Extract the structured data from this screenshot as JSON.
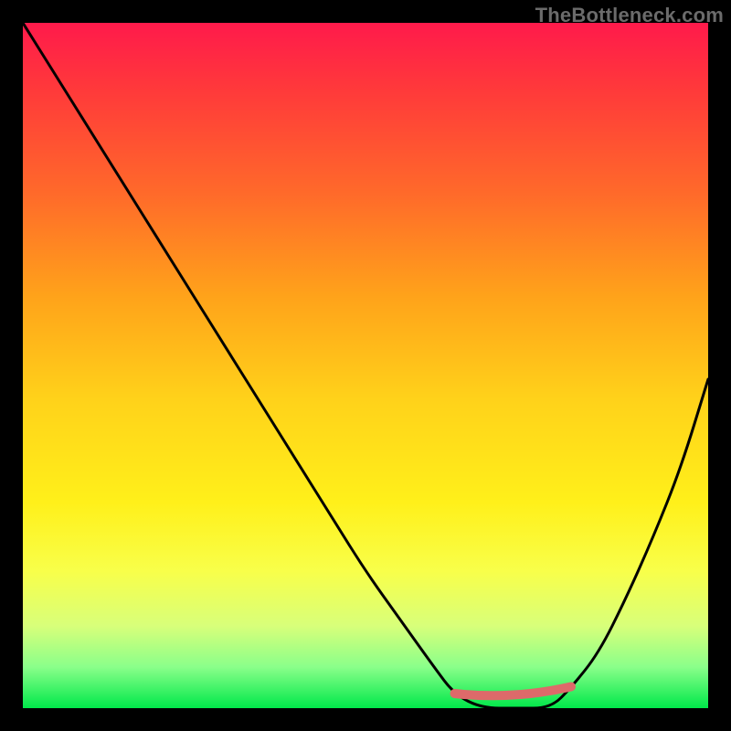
{
  "watermark": "TheBottleneck.com",
  "chart_data": {
    "type": "line",
    "title": "",
    "xlabel": "",
    "ylabel": "",
    "xlim": [
      0,
      100
    ],
    "ylim": [
      0,
      100
    ],
    "series": [
      {
        "name": "bottleneck-curve",
        "x": [
          0,
          5,
          10,
          15,
          20,
          25,
          30,
          35,
          40,
          45,
          50,
          55,
          60,
          63,
          67,
          72,
          77,
          80,
          84,
          88,
          92,
          96,
          100
        ],
        "values": [
          100,
          92,
          84,
          76,
          68,
          60,
          52,
          44,
          36,
          28,
          20,
          13,
          6,
          2,
          0,
          0,
          0,
          3,
          8,
          16,
          25,
          35,
          48
        ]
      }
    ],
    "flat_segment": {
      "x_start": 63,
      "x_end": 80
    },
    "flat_segment_color": "#dd6a6a",
    "curve_color": "#000000",
    "background": "gradient-red-orange-yellow-green",
    "frame_color": "#000000"
  }
}
